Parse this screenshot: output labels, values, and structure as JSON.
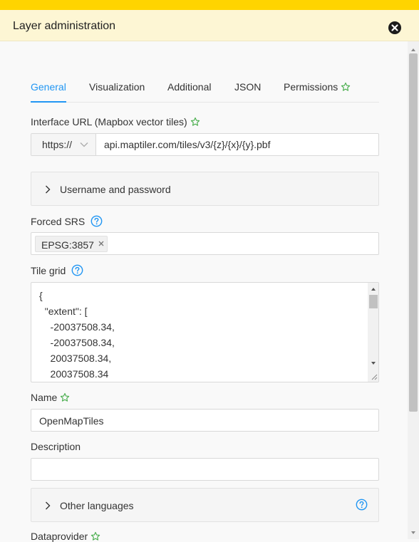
{
  "window": {
    "title": "Layer administration",
    "close_icon": "close-circle-icon"
  },
  "tabs": [
    {
      "label": "General",
      "active": true
    },
    {
      "label": "Visualization",
      "active": false
    },
    {
      "label": "Additional",
      "active": false
    },
    {
      "label": "JSON",
      "active": false
    },
    {
      "label": "Permissions",
      "active": false,
      "star": true
    }
  ],
  "interface_url": {
    "label": "Interface URL (Mapbox vector tiles)",
    "protocol": "https://",
    "value": "api.maptiler.com/tiles/v3/{z}/{x}/{y}.pbf"
  },
  "credentials": {
    "label": "Username and password"
  },
  "forced_srs": {
    "label": "Forced SRS",
    "tags": [
      "EPSG:3857"
    ]
  },
  "tile_grid": {
    "label": "Tile grid",
    "value": "{\n  \"extent\": [\n    -20037508.34,\n    -20037508.34,\n    20037508.34,\n    20037508.34"
  },
  "name": {
    "label": "Name",
    "value": "OpenMapTiles"
  },
  "description": {
    "label": "Description",
    "value": ""
  },
  "other_languages": {
    "label": "Other languages"
  },
  "dataprovider": {
    "label": "Dataprovider"
  },
  "colors": {
    "accent": "#2196f3",
    "star": "#4caf50",
    "brand_stripe": "#ffd400",
    "header_bg": "#fdf6d4"
  }
}
